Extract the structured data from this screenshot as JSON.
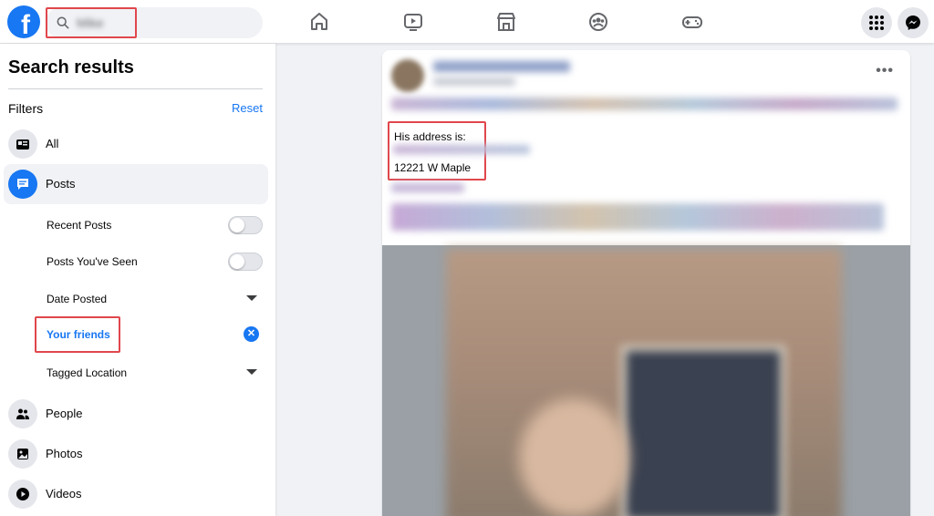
{
  "topbar": {
    "logo": "f",
    "search_value": "Mike",
    "nav_icons": [
      "home-icon",
      "watch-icon",
      "marketplace-icon",
      "groups-icon",
      "gaming-icon"
    ],
    "right_buttons": [
      "menu-grid-icon",
      "messenger-icon"
    ]
  },
  "sidebar": {
    "title": "Search results",
    "filters_label": "Filters",
    "reset_label": "Reset",
    "items": [
      {
        "label": "All",
        "icon": "all-results-icon"
      },
      {
        "label": "Posts",
        "icon": "posts-icon",
        "active": true
      },
      {
        "label": "People",
        "icon": "people-icon"
      },
      {
        "label": "Photos",
        "icon": "photos-icon"
      },
      {
        "label": "Videos",
        "icon": "videos-icon"
      }
    ],
    "post_filters": {
      "recent_posts": "Recent Posts",
      "posts_seen": "Posts You've Seen",
      "date_posted": "Date Posted",
      "your_friends": "Your friends",
      "tagged_location": "Tagged Location"
    },
    "clear_symbol": "✕"
  },
  "post": {
    "more": "•••",
    "address_intro": "His address is:",
    "address_value": "12221  W Maple"
  },
  "colors": {
    "accent": "#1877f2",
    "highlight": "#e0474c"
  }
}
